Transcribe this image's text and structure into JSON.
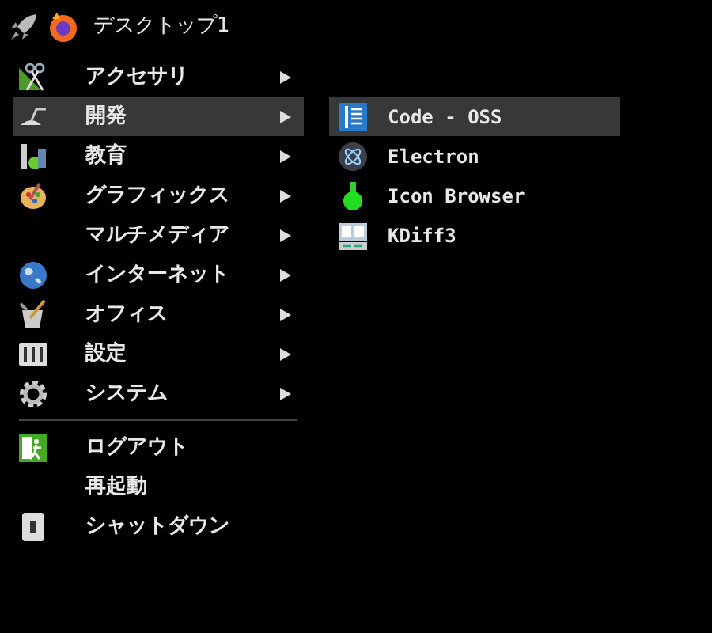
{
  "panel": {
    "title": "デスクトップ1"
  },
  "menu": {
    "items": [
      {
        "kind": "submenu",
        "label": "アクセサリ",
        "selected": false
      },
      {
        "kind": "submenu",
        "label": "開発",
        "selected": true
      },
      {
        "kind": "submenu",
        "label": "教育",
        "selected": false
      },
      {
        "kind": "submenu",
        "label": "グラフィックス",
        "selected": false
      },
      {
        "kind": "submenu",
        "label": "マルチメディア",
        "selected": false
      },
      {
        "kind": "submenu",
        "label": "インターネット",
        "selected": false
      },
      {
        "kind": "submenu",
        "label": "オフィス",
        "selected": false
      },
      {
        "kind": "submenu",
        "label": "設定",
        "selected": false
      },
      {
        "kind": "submenu",
        "label": "システム",
        "selected": false
      },
      {
        "kind": "separator"
      },
      {
        "kind": "action",
        "label": "ログアウト",
        "selected": false
      },
      {
        "kind": "action",
        "label": "再起動",
        "selected": false
      },
      {
        "kind": "action",
        "label": "シャットダウン",
        "selected": false
      }
    ]
  },
  "submenu": {
    "items": [
      {
        "label": "Code - OSS",
        "selected": true
      },
      {
        "label": "Electron",
        "selected": false
      },
      {
        "label": "Icon Browser",
        "selected": false
      },
      {
        "label": "KDiff3",
        "selected": false
      }
    ]
  }
}
